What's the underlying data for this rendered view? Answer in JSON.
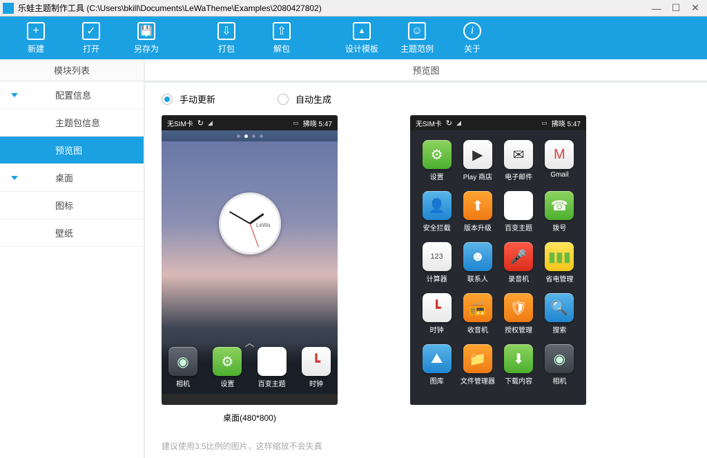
{
  "window": {
    "title": "乐蛙主题制作工具 (C:\\Users\\bkill\\Documents\\LeWaTheme\\Examples\\2080427802)"
  },
  "toolbar": {
    "new": "新建",
    "open": "打开",
    "saveas": "另存为",
    "pack": "打包",
    "unpack": "解包",
    "template": "设计模板",
    "example": "主题范例",
    "about": "关于"
  },
  "sidebar": {
    "header": "模块列表",
    "config": "配置信息",
    "themepkg": "主题包信息",
    "preview": "预览图",
    "desktop": "桌面",
    "icons": "图标",
    "wallpaper": "壁纸"
  },
  "content": {
    "header": "预览图",
    "radio_manual": "手动更新",
    "radio_auto": "自动生成",
    "caption1": "桌面(480*800)",
    "hint": "建议使用3:5比例的图片，这样缩放不会失真"
  },
  "phone": {
    "nosim": "无SIM卡",
    "time": "拂晓 5:47",
    "clock_brand": "LeWa",
    "apps1": {
      "camera": "相机",
      "settings": "设置",
      "theme": "百变主题",
      "clock": "时钟"
    },
    "apps2": {
      "settings": "设置",
      "playstore": "Play 商店",
      "email": "电子邮件",
      "gmail": "Gmail",
      "security": "安全拦截",
      "upgrade": "版本升级",
      "theme": "百变主题",
      "dial": "拨号",
      "calc": "计算器",
      "contacts": "联系人",
      "recorder": "录音机",
      "power": "省电管理",
      "clock": "时钟",
      "radio": "收音机",
      "auth": "授权管理",
      "search": "搜索",
      "gallery": "图库",
      "files": "文件管理器",
      "downloads": "下载内容",
      "camera": "相机"
    }
  }
}
